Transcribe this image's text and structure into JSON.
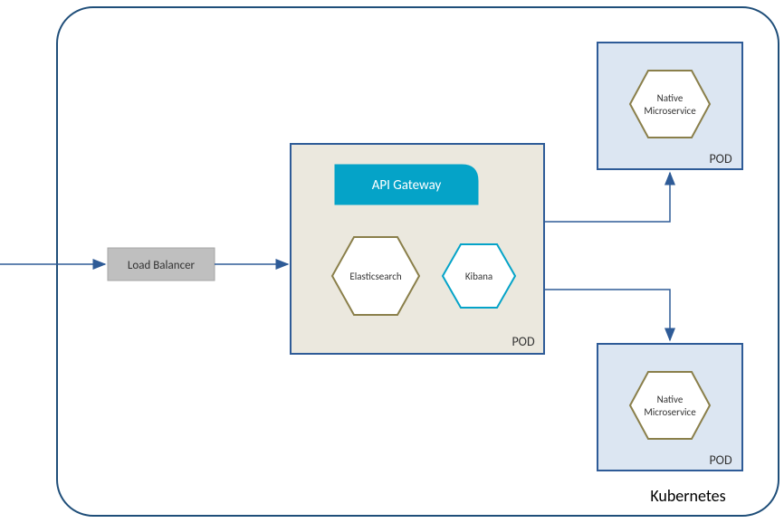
{
  "container": {
    "label": "Kubernetes"
  },
  "loadBalancer": {
    "label": "Load Balancer"
  },
  "mainPod": {
    "label": "POD",
    "apiGateway": {
      "label": "API Gateway"
    },
    "elasticsearch": {
      "label": "Elasticsearch"
    },
    "kibana": {
      "label": "Kibana"
    }
  },
  "topPod": {
    "label": "POD",
    "service": {
      "line1": "Native",
      "line2": "Microservice"
    }
  },
  "bottomPod": {
    "label": "POD",
    "service": {
      "line1": "Native",
      "line2": "Microservice"
    }
  },
  "colors": {
    "containerStroke": "#1f4e79",
    "podStroke": "#2e5b97",
    "podTopFill": "#dce6f2",
    "mainPodFill": "#ebe8de",
    "lbFill": "#bfbfbf",
    "apiFill": "#05a3c8",
    "hexStroke": "#8a7f4a",
    "kibanaStroke": "#05a3c8",
    "arrow": "#2e5b97"
  }
}
